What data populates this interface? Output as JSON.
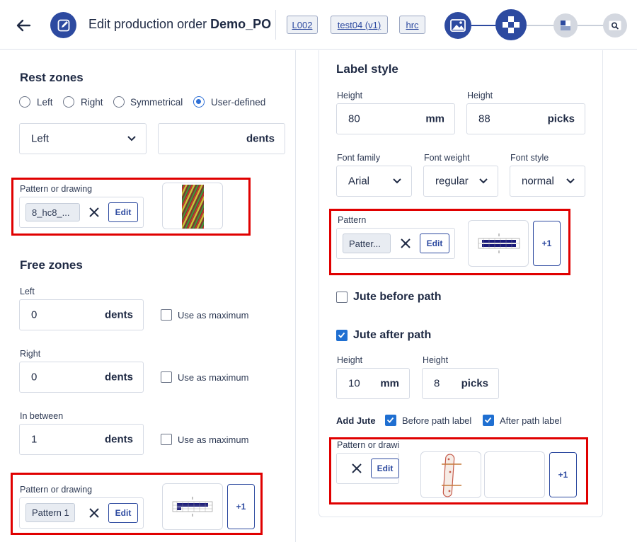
{
  "header": {
    "title_prefix": "Edit production order ",
    "title_name": "Demo_PO",
    "chips": [
      "L002",
      "test04 (v1)",
      "hrc"
    ],
    "steps": [
      "image-step",
      "pattern-step",
      "layout-step",
      "search-step"
    ]
  },
  "rest_zones": {
    "title": "Rest zones",
    "options": [
      "Left",
      "Right",
      "Symmetrical",
      "User-defined"
    ],
    "selected": "User-defined",
    "side_select": "Left",
    "dents_unit": "dents",
    "pattern_label": "Pattern or drawing",
    "pattern_tag": "8_hc8_...",
    "edit": "Edit"
  },
  "free_zones": {
    "title": "Free zones",
    "left_label": "Left",
    "left_value": "0",
    "right_label": "Right",
    "right_value": "0",
    "between_label": "In between",
    "between_value": "1",
    "unit": "dents",
    "use_max": "Use as maximum",
    "pattern_label": "Pattern or drawing",
    "pattern_tag": "Pattern 1",
    "edit": "Edit",
    "plus": "+1"
  },
  "label_style": {
    "title": "Label style",
    "height1_label": "Height",
    "height1_value": "80",
    "height1_unit": "mm",
    "height2_label": "Height",
    "height2_value": "88",
    "height2_unit": "picks",
    "font_family_label": "Font family",
    "font_family": "Arial",
    "font_weight_label": "Font weight",
    "font_weight": "regular",
    "font_style_label": "Font style",
    "font_style": "normal",
    "pattern_label": "Pattern",
    "pattern_tag": "Patter...",
    "edit": "Edit",
    "plus": "+1"
  },
  "jute": {
    "before_label": "Jute before path",
    "before_checked": false,
    "after_label": "Jute after path",
    "after_checked": true,
    "height1_label": "Height",
    "height1_value": "10",
    "height1_unit": "mm",
    "height2_label": "Height",
    "height2_value": "8",
    "height2_unit": "picks",
    "add_jute": "Add Jute",
    "before_path_label": "Before path label",
    "after_path_label": "After path label",
    "pattern_label": "Pattern or drawi",
    "edit": "Edit",
    "plus": "+1"
  },
  "colors": {
    "accent": "#2d4aa0",
    "checkbox": "#1f6fd1",
    "highlight": "#e00000"
  }
}
